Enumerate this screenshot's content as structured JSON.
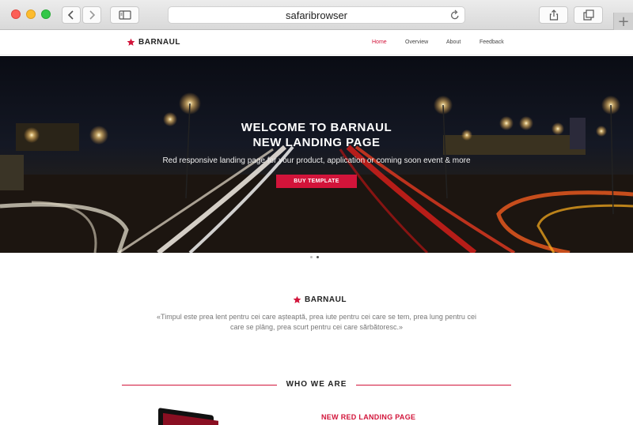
{
  "browser": {
    "address": "safaribrowser",
    "new_tab_label": "+",
    "icons": {
      "back": "chevron-left-icon",
      "forward": "chevron-right-icon",
      "sidebar": "sidebar-icon",
      "reload": "reload-icon",
      "share": "share-icon",
      "tabs": "tabs-icon"
    }
  },
  "site": {
    "brand": "BARNAUL",
    "accent_color": "#d2143a",
    "nav": [
      {
        "label": "Home",
        "active": true
      },
      {
        "label": "Overview",
        "active": false
      },
      {
        "label": "About",
        "active": false
      },
      {
        "label": "Feedback",
        "active": false
      }
    ]
  },
  "hero": {
    "title_line1": "WELCOME TO BARNAUL",
    "title_line2": "NEW LANDING PAGE",
    "subtitle": "Red responsive landing page for your product, application or coming soon event & more",
    "button": "BUY TEMPLATE",
    "slides": 2,
    "active_slide": 2
  },
  "about": {
    "brand": "BARNAUL",
    "quote": "«Timpul este prea lent pentru cei care așteaptă, prea iute pentru cei care se tem, prea lung pentru cei care se plâng, prea scurt pentru cei care sărbătoresc.»"
  },
  "who": {
    "title": "WHO WE ARE",
    "subheading": "NEW RED LANDING PAGE"
  }
}
